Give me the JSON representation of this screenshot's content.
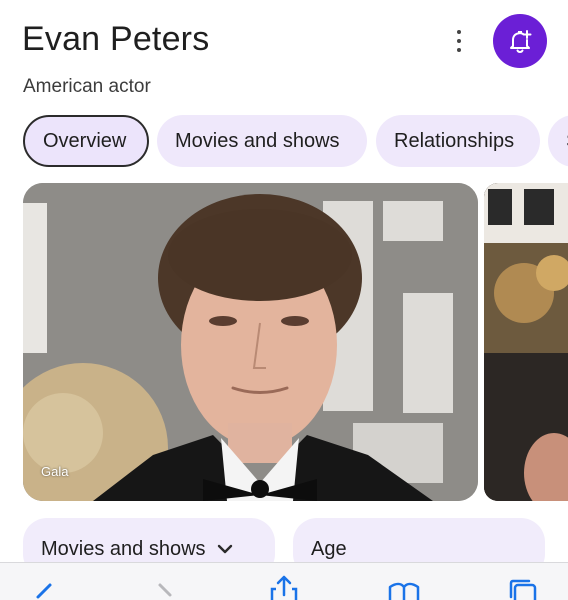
{
  "header": {
    "title": "Evan Peters",
    "subtitle": "American actor"
  },
  "icons": {
    "more": "kebab-menu-icon",
    "follow": "bell-plus-icon",
    "follow_button_color": "#6b1fd6"
  },
  "tabs": [
    {
      "label": "Overview",
      "selected": true
    },
    {
      "label": "Movies and shows",
      "selected": false
    },
    {
      "label": "Relationships",
      "selected": false
    },
    {
      "label": "S",
      "selected": false
    }
  ],
  "images": {
    "main_caption": "Gala"
  },
  "cards": [
    {
      "label": "Movies and shows"
    },
    {
      "label": "Age"
    }
  ],
  "toolbar": {
    "items": [
      "back-icon",
      "forward-icon",
      "share-icon",
      "bookmarks-icon",
      "tabs-icon"
    ]
  }
}
